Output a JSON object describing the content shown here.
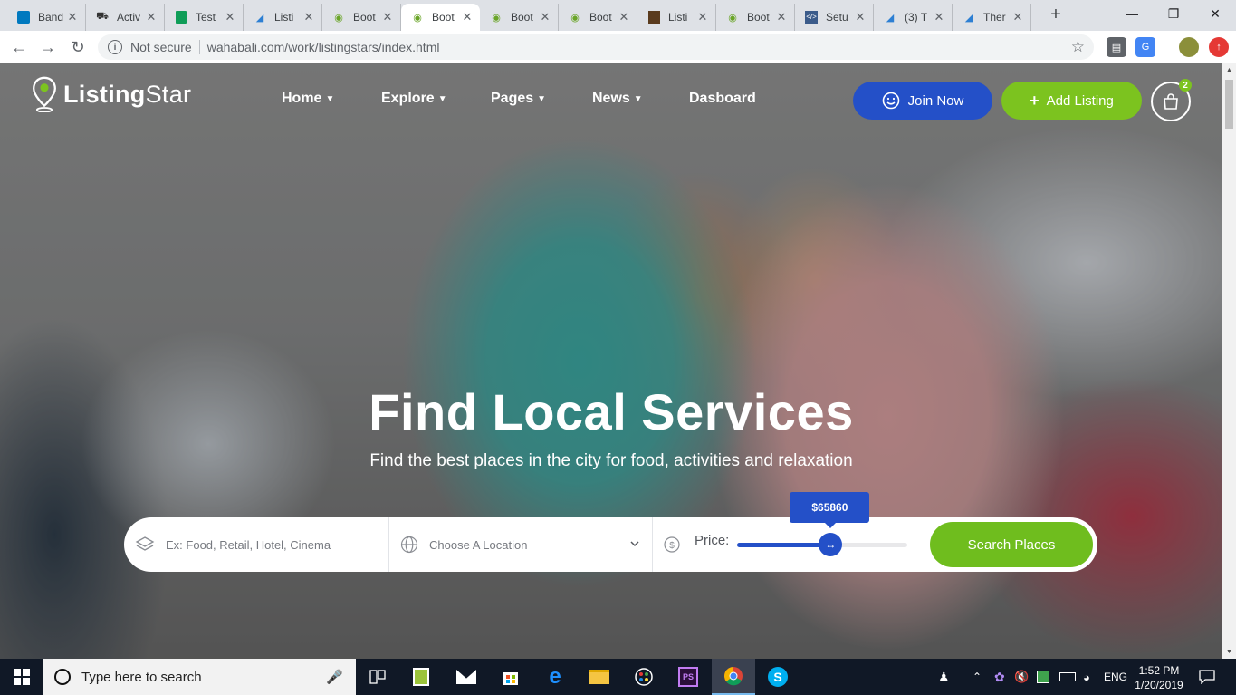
{
  "browser": {
    "tabs": [
      {
        "title": "Band",
        "icon": "trello-icon",
        "active": false
      },
      {
        "title": "Activ",
        "icon": "car-icon",
        "active": false
      },
      {
        "title": "Test",
        "icon": "sheets-icon",
        "active": false
      },
      {
        "title": "Listi",
        "icon": "listing-icon",
        "active": false
      },
      {
        "title": "Boot",
        "icon": "pin-icon",
        "active": false
      },
      {
        "title": "Boot",
        "icon": "pin-icon",
        "active": true
      },
      {
        "title": "Boot",
        "icon": "pin-icon",
        "active": false
      },
      {
        "title": "Boot",
        "icon": "pin-icon",
        "active": false
      },
      {
        "title": "Listi",
        "icon": "photo-icon",
        "active": false
      },
      {
        "title": "Boot",
        "icon": "pin-icon",
        "active": false
      },
      {
        "title": "Setu",
        "icon": "code-icon",
        "active": false
      },
      {
        "title": "(3) T",
        "icon": "listing-icon",
        "active": false
      },
      {
        "title": "Ther",
        "icon": "listing-icon",
        "active": false
      }
    ],
    "security_label": "Not secure",
    "url": "wahabali.com/work/listingstars/index.html",
    "colors": {
      "tab_strip": "#dee1e6",
      "toolbar": "#ffffff"
    }
  },
  "site": {
    "logo": {
      "bold": "Listing",
      "thin": "Star"
    },
    "nav": [
      {
        "label": "Home",
        "dropdown": true
      },
      {
        "label": "Explore",
        "dropdown": true
      },
      {
        "label": "Pages",
        "dropdown": true
      },
      {
        "label": "News",
        "dropdown": true
      },
      {
        "label": "Dasboard",
        "dropdown": false
      }
    ],
    "join_label": "Join Now",
    "add_listing_label": "Add Listing",
    "cart_count": "2",
    "hero_title": "Find Local Services",
    "hero_subtitle": "Find the best places in the city for food, activities and relaxation",
    "search": {
      "keyword_placeholder": "Ex: Food, Retail, Hotel, Cinema",
      "location_placeholder": "Choose A Location",
      "price_label": "Price:",
      "price_value": "$65860",
      "price_fraction": 0.55,
      "button_label": "Search Places"
    },
    "colors": {
      "primary_blue": "#2450c8",
      "accent_green": "#7cc31f",
      "white": "#ffffff"
    }
  },
  "taskbar": {
    "search_placeholder": "Type here to search",
    "apps": [
      "task-view-icon",
      "notepad-icon",
      "mail-icon",
      "store-icon",
      "edge-icon",
      "file-explorer-icon",
      "paint-icon",
      "photoshop-icon",
      "chrome-icon",
      "skype-icon"
    ],
    "language": "ENG",
    "time": "1:52 PM",
    "date": "1/20/2019"
  }
}
